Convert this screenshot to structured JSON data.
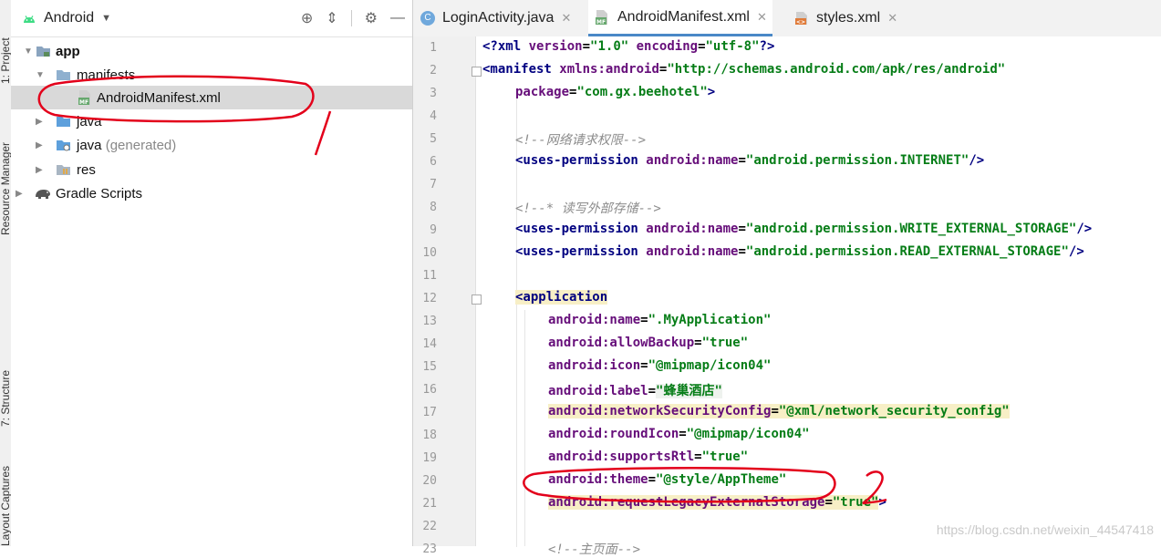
{
  "sidebar_strip": {
    "tab_project": "1: Project",
    "tab_resource_manager": "Resource Manager",
    "tab_structure": "7: Structure",
    "tab_layout_captures": "Layout Captures"
  },
  "project_panel": {
    "view_selector": "Android",
    "tree": [
      {
        "label": "app",
        "bold": true
      },
      {
        "label": "manifests"
      },
      {
        "label": "AndroidManifest.xml"
      },
      {
        "label": "java"
      },
      {
        "label": "java",
        "suffix": "(generated)"
      },
      {
        "label": "res"
      },
      {
        "label": "Gradle Scripts"
      }
    ]
  },
  "editor_tabs": [
    {
      "label": "LoginActivity.java",
      "icon": "class-icon"
    },
    {
      "label": "AndroidManifest.xml",
      "icon": "manifest-icon",
      "active": true
    },
    {
      "label": "styles.xml",
      "icon": "xml-icon"
    }
  ],
  "code_lines": [
    {
      "n": "1"
    },
    {
      "n": "2"
    },
    {
      "n": "3"
    },
    {
      "n": "4"
    },
    {
      "n": "5"
    },
    {
      "n": "6"
    },
    {
      "n": "7"
    },
    {
      "n": "8"
    },
    {
      "n": "9"
    },
    {
      "n": "10"
    },
    {
      "n": "11"
    },
    {
      "n": "12"
    },
    {
      "n": "13"
    },
    {
      "n": "14"
    },
    {
      "n": "15"
    },
    {
      "n": "16"
    },
    {
      "n": "17"
    },
    {
      "n": "18"
    },
    {
      "n": "19"
    },
    {
      "n": "20"
    },
    {
      "n": "21"
    },
    {
      "n": "22"
    },
    {
      "n": "23"
    }
  ],
  "code": {
    "l1_pi_open": "<?xml ",
    "l1_a1": "version",
    "l1_v1": "\"1.0\"",
    "l1_a2": "encoding",
    "l1_v2": "\"utf-8\"",
    "l1_pi_close": "?>",
    "l2_tag": "<manifest ",
    "l2_attr": "xmlns:android",
    "l2_val": "\"http://schemas.android.com/apk/res/android\"",
    "l3_attr": "package",
    "l3_val": "\"com.gx.beehotel\"",
    "l3_end": ">",
    "l5_comment": "<!--网络请求权限-->",
    "l6_tag": "<uses-permission ",
    "l6_attr": "android:name",
    "l6_val": "\"android.permission.INTERNET\"",
    "l6_end": "/>",
    "l8_comment": "<!--* 读写外部存储-->",
    "l9_tag": "<uses-permission ",
    "l9_attr": "android:name",
    "l9_val": "\"android.permission.WRITE_EXTERNAL_STORAGE\"",
    "l9_end": "/>",
    "l10_tag": "<uses-permission ",
    "l10_attr": "android:name",
    "l10_val": "\"android.permission.READ_EXTERNAL_STORAGE\"",
    "l10_end": "/>",
    "l12_tag": "<application",
    "l13_attr": "android:name",
    "l13_val": "\".MyApplication\"",
    "l14_attr": "android:allowBackup",
    "l14_val": "\"true\"",
    "l15_attr": "android:icon",
    "l15_val": "\"@mipmap/icon04\"",
    "l16_attr": "android:label",
    "l16_val": "\"蜂巢酒店\"",
    "l17_attr": "android:networkSecurityConfig",
    "l17_val": "\"@xml/network_security_config\"",
    "l18_attr": "android:roundIcon",
    "l18_val": "\"@mipmap/icon04\"",
    "l19_attr": "android:supportsRtl",
    "l19_val": "\"true\"",
    "l20_attr": "android:theme",
    "l20_val": "\"@style/AppTheme\"",
    "l21_attr": "android:requestLegacyExternalStorage",
    "l21_val": "\"true\"",
    "l21_end": ">",
    "l23_comment": "<!--主页面-->"
  },
  "watermark": "https://blog.csdn.net/weixin_44547418",
  "colors": {
    "accent_tab_underline": "#4a88c7",
    "annotation_red": "#e3001b",
    "highlight_yellow": "#f7efc6"
  }
}
